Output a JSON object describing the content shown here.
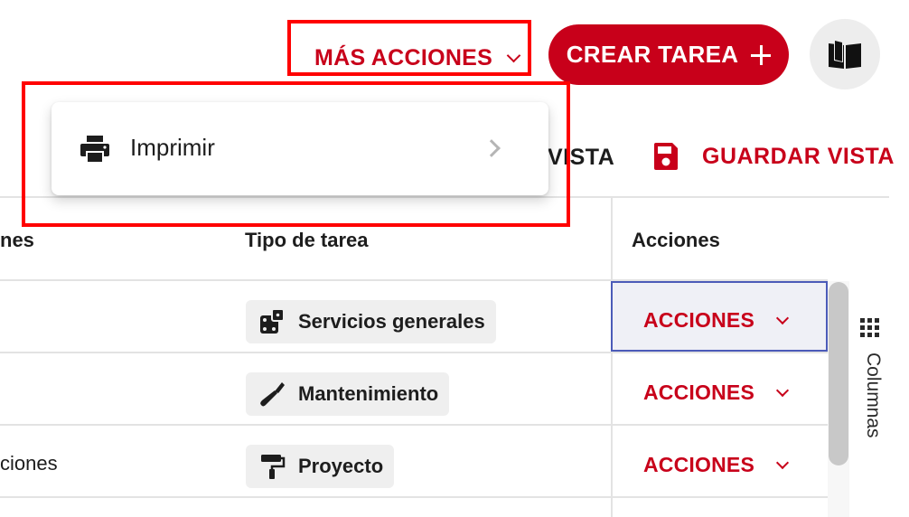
{
  "header": {
    "more_actions_label": "MÁS ACCIONES",
    "create_task_label": "CREAR TAREA"
  },
  "view_bar": {
    "view_label_partial": "VISTA",
    "save_view_label": "GUARDAR VISTA"
  },
  "dropdown": {
    "items": [
      {
        "label": "Imprimir"
      }
    ]
  },
  "table": {
    "headers": [
      "nes",
      "Tipo de tarea",
      "Acciones"
    ],
    "rows": [
      {
        "first_col": "",
        "task_type": "Servicios generales",
        "task_icon": "dice-icon",
        "action": "ACCIONES"
      },
      {
        "first_col": "",
        "task_type": "Mantenimiento",
        "task_icon": "wrench-icon",
        "action": "ACCIONES"
      },
      {
        "first_col": "ciones",
        "task_type": "Proyecto",
        "task_icon": "paint-roller-icon",
        "action": "ACCIONES"
      }
    ]
  },
  "side_panel": {
    "columns_label": "Columnas"
  },
  "colors": {
    "accent": "#c8001a",
    "highlight": "#ff0000",
    "selected_cell_border": "#4b5bb8"
  }
}
